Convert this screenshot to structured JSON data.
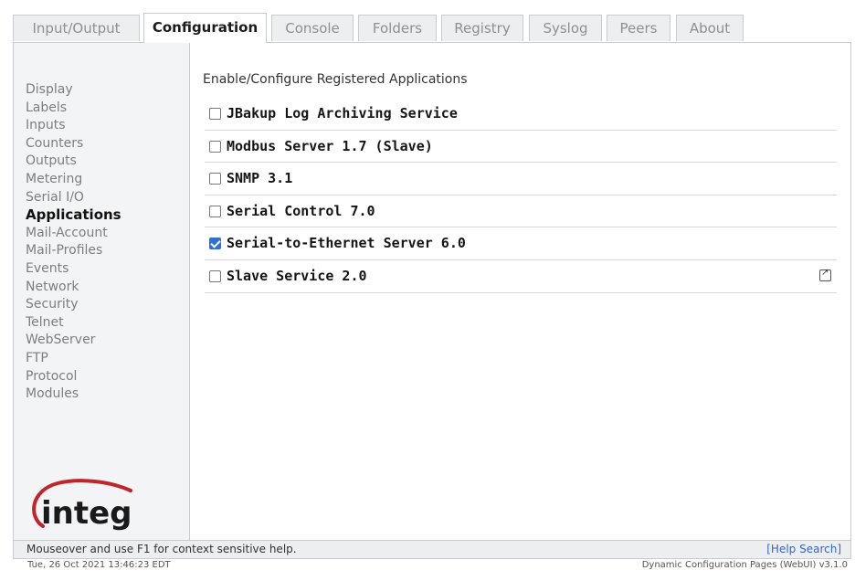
{
  "tabs": [
    {
      "label": "Input/Output",
      "active": false
    },
    {
      "label": "Configuration",
      "active": true
    },
    {
      "label": "Console",
      "active": false
    },
    {
      "label": "Folders",
      "active": false
    },
    {
      "label": "Registry",
      "active": false
    },
    {
      "label": "Syslog",
      "active": false
    },
    {
      "label": "Peers",
      "active": false
    },
    {
      "label": "About",
      "active": false
    }
  ],
  "sidebar": {
    "items": [
      {
        "label": "Display"
      },
      {
        "label": "Labels"
      },
      {
        "label": "Inputs"
      },
      {
        "label": "Counters"
      },
      {
        "label": "Outputs"
      },
      {
        "label": "Metering"
      },
      {
        "label": "Serial I/O"
      },
      {
        "label": "Applications",
        "active": true
      },
      {
        "label": "Mail-Account"
      },
      {
        "label": "Mail-Profiles"
      },
      {
        "label": "Events"
      },
      {
        "label": "Network"
      },
      {
        "label": "Security"
      },
      {
        "label": "Telnet"
      },
      {
        "label": "WebServer"
      },
      {
        "label": "FTP"
      },
      {
        "label": "Protocol"
      },
      {
        "label": "Modules"
      }
    ],
    "logo_text": "integ"
  },
  "main": {
    "title": "Enable/Configure Registered Applications",
    "applications": [
      {
        "label": "JBakup Log Archiving Service",
        "checked": false
      },
      {
        "label": "Modbus Server 1.7 (Slave)",
        "checked": false
      },
      {
        "label": "SNMP 3.1",
        "checked": false
      },
      {
        "label": "Serial Control 7.0",
        "checked": false
      },
      {
        "label": "Serial-to-Ethernet Server 6.0",
        "checked": true
      },
      {
        "label": "Slave Service 2.0",
        "checked": false,
        "icon": "external-link-icon"
      }
    ]
  },
  "helpbar": {
    "message": "Mouseover and use F1 for context sensitive help.",
    "link": "[Help Search]"
  },
  "footer": {
    "timestamp": "Tue, 26 Oct 2021 13:46:23 EDT",
    "version": "Dynamic Configuration Pages (WebUI) v3.1.0"
  },
  "colors": {
    "accent_checkbox": "#2f6fd6",
    "link": "#3366cc",
    "logo_red": "#c0252b",
    "logo_text": "#1a1a1a"
  }
}
